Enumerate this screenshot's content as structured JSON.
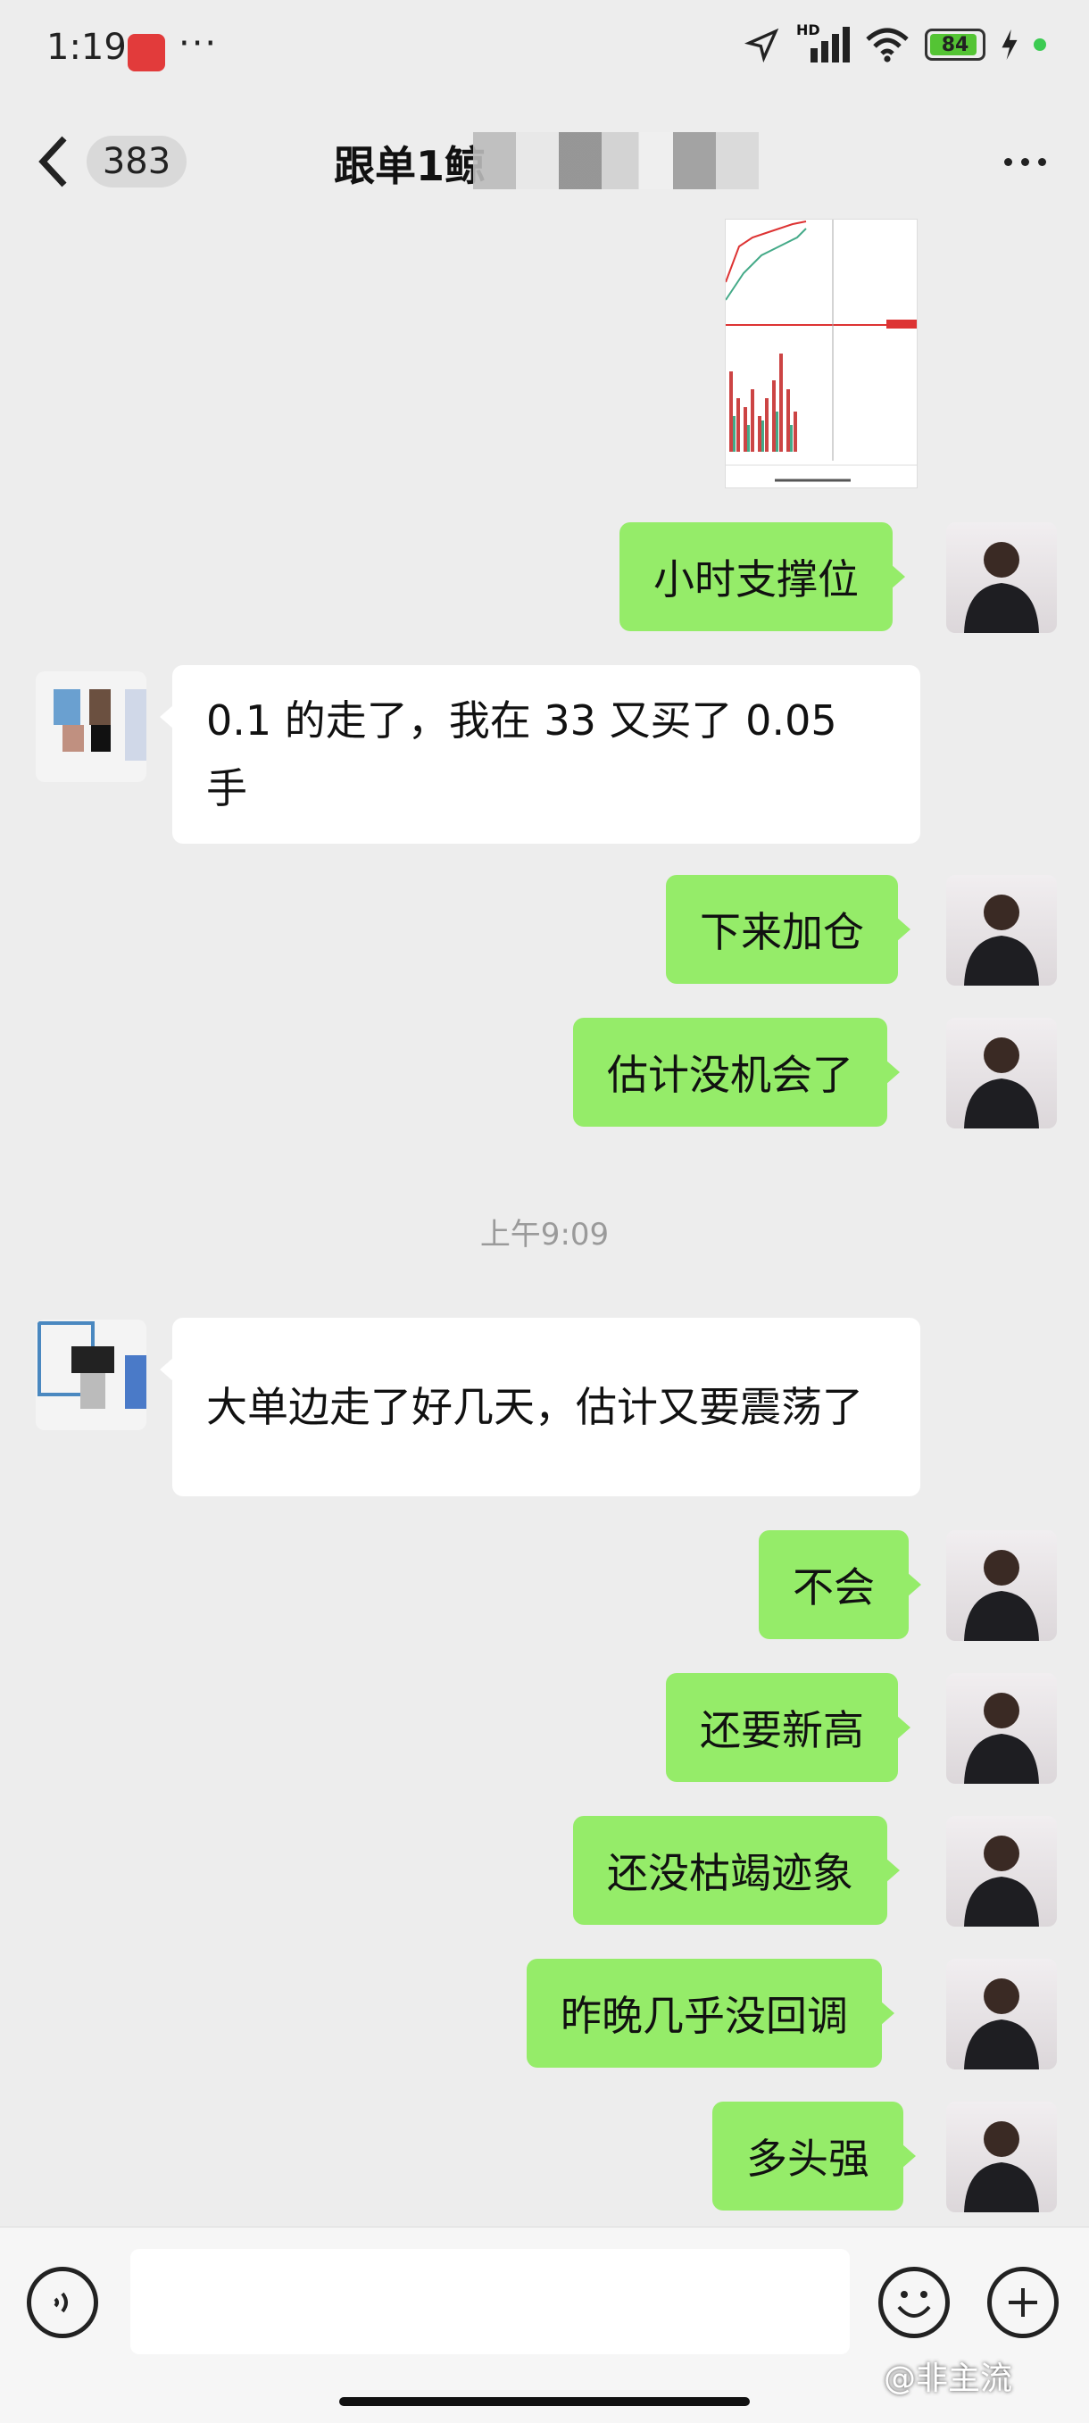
{
  "status_bar": {
    "time": "1:19",
    "dots": "···",
    "hd": "HD",
    "battery": "84"
  },
  "header": {
    "back_badge": "383",
    "title": "跟单1鲸"
  },
  "chat": {
    "messages": [
      {
        "from": "me",
        "text": "小时支撑位"
      },
      {
        "from": "other",
        "text": "0.1 的走了，我在 33 又买了 0.05 手"
      },
      {
        "from": "me",
        "text": "下来加仓"
      },
      {
        "from": "me",
        "text": "估计没机会了"
      },
      {
        "from": "me",
        "text": "不会"
      },
      {
        "from": "me",
        "text": "还要新高"
      },
      {
        "from": "me",
        "text": "还没枯竭迹象"
      },
      {
        "from": "me",
        "text": "昨晚几乎没回调"
      },
      {
        "from": "me",
        "text": "多头强"
      }
    ],
    "timestamp": "上午9:09",
    "other_message_2": "大单边走了好几天，估计又要震荡了"
  },
  "input_bar": {
    "watermark": "@非主流"
  },
  "colors": {
    "self_bubble": "#95ec69",
    "other_bubble": "#ffffff",
    "background": "#ededed"
  }
}
